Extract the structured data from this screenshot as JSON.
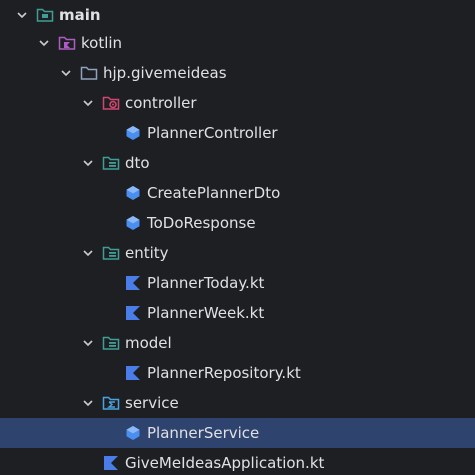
{
  "tree": {
    "root": {
      "label": "main"
    },
    "kotlin": {
      "label": "kotlin"
    },
    "package": {
      "label": "hjp.givemeideas"
    },
    "controller": {
      "label": "controller",
      "children": [
        "PlannerController"
      ]
    },
    "dto": {
      "label": "dto",
      "children": [
        "CreatePlannerDto",
        "ToDoResponse"
      ]
    },
    "entity": {
      "label": "entity",
      "children": [
        "PlannerToday.kt",
        "PlannerWeek.kt"
      ]
    },
    "model": {
      "label": "model",
      "children": [
        "PlannerRepository.kt"
      ]
    },
    "service": {
      "label": "service",
      "children": [
        "PlannerService"
      ]
    },
    "app_file": {
      "label": "GiveMeIdeasApplication.kt"
    }
  },
  "selected_item": "PlannerService",
  "colors": {
    "background": "#1e1f22",
    "selection": "#2e436e",
    "text": "#dfe1e5",
    "folder_teal": "#3f9e95",
    "kotlin_purple": "#b05cc6",
    "controller_pink": "#d2466e",
    "class_blue": "#4a8ff0",
    "kotlin_file_blue": "#4a7de8"
  },
  "icons": {
    "expanded": "chevron-down-icon",
    "source_folder": "source-root-folder-icon",
    "kotlin_folder": "kotlin-folder-icon",
    "package": "package-folder-icon",
    "controller": "controller-folder-icon",
    "dto": "dto-folder-icon",
    "class": "class-icon",
    "kotlin_file": "kotlin-file-icon",
    "service": "service-folder-icon"
  }
}
